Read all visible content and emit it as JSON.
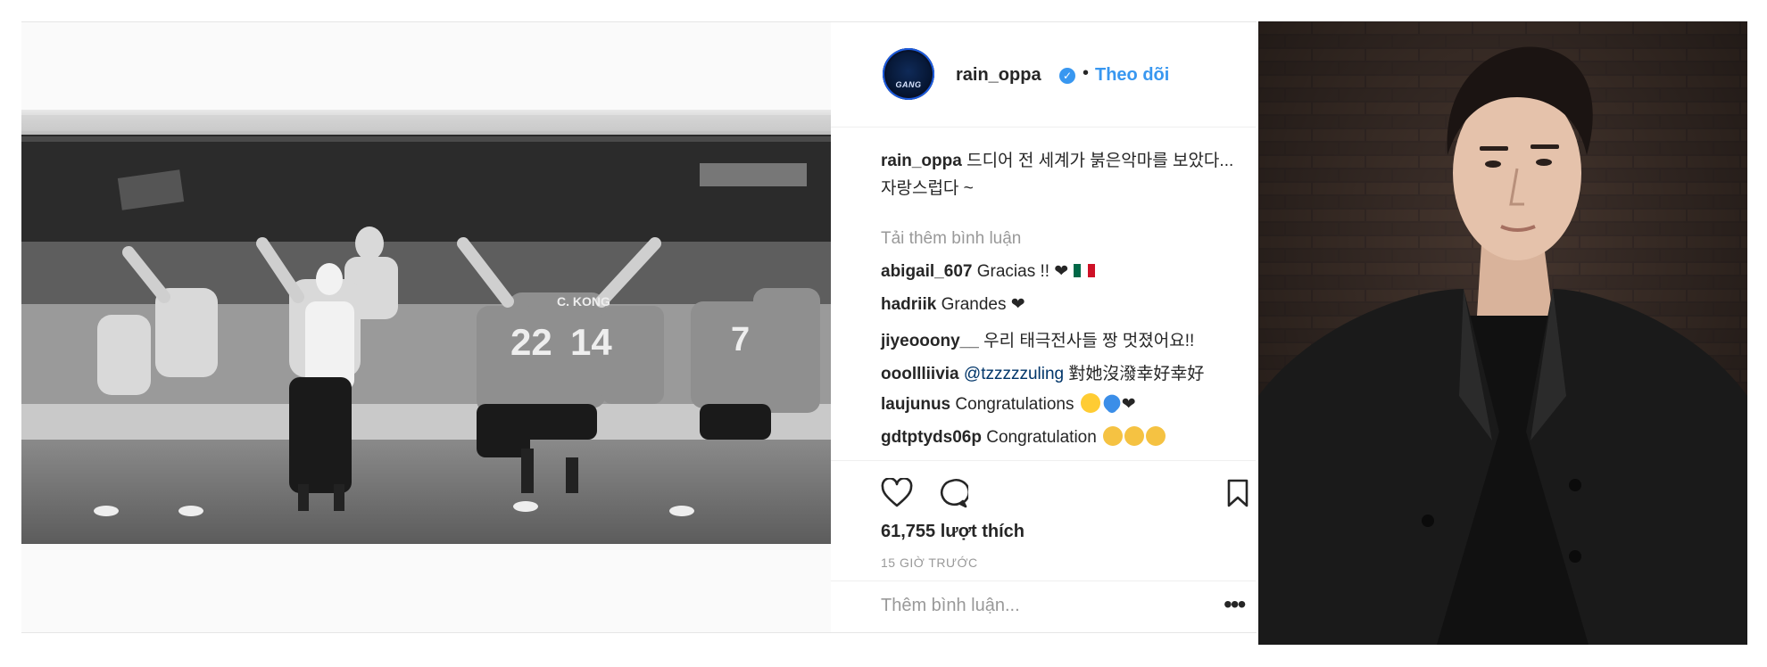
{
  "post": {
    "author": {
      "username": "rain_oppa",
      "verified_icon": "verified-badge-icon",
      "separator": "•",
      "follow_label": "Theo dõi",
      "avatar_text": "GANG"
    },
    "caption": {
      "username": "rain_oppa",
      "text": "드디어 전 세계가 붉은악마를 보았다... 자랑스럽다 ~"
    },
    "load_more_label": "Tải thêm bình luận",
    "comments": [
      {
        "username": "abigail_607",
        "text": "Gracias !! ❤",
        "extra": "mexico-flag"
      },
      {
        "username": "hadriik",
        "text": "Grandes ❤"
      },
      {
        "username": "jiyeooony__",
        "text": "우리 태극전사들 짱 멋졌어요!!"
      },
      {
        "username": "ooollliivia",
        "mention": "@tzzzzzuling",
        "text": "對她沒潑幸好幸好"
      },
      {
        "username": "laujunus",
        "text": "Congratulations",
        "extra": "heart-eyes-blue-heart-black-heart"
      },
      {
        "username": "gdtptyds06p",
        "text": "Congratulation",
        "extra": "clapping-hands-x3"
      }
    ],
    "likes_label": "61,755 lượt thích",
    "time_label": "15 GIỜ TRƯỚC",
    "add_comment_placeholder": "Thêm bình luận...",
    "more_options": "•••",
    "icons": {
      "like": "heart-icon",
      "comment": "comment-bubble-icon",
      "save": "bookmark-icon",
      "more": "more-options-icon"
    },
    "colors": {
      "link_blue": "#3897f0",
      "text": "#262626",
      "muted": "#999999",
      "border": "#efefef"
    }
  },
  "photo": {
    "jersey_numbers": [
      "22",
      "14",
      "7"
    ],
    "jersey_name": "C. KONG"
  }
}
